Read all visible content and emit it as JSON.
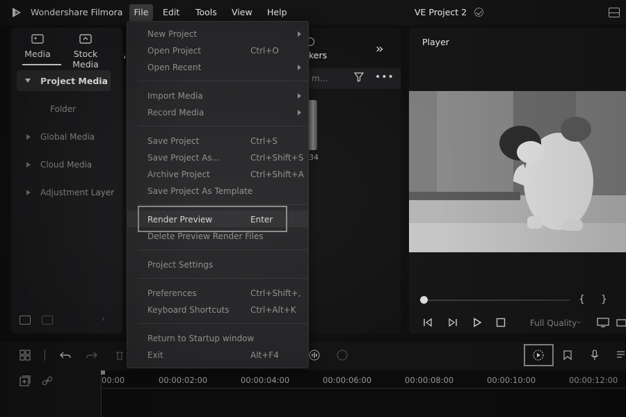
{
  "titlebar": {
    "app_name": "Wondershare Filmora",
    "menus": [
      "File",
      "Edit",
      "Tools",
      "View",
      "Help"
    ],
    "project_title": "VE Project 2"
  },
  "media_panel": {
    "tabs": [
      "Media",
      "Stock Media",
      "A"
    ],
    "items": [
      {
        "label": "Project Media",
        "active": true
      },
      {
        "label": "Folder"
      },
      {
        "label": "Global Media"
      },
      {
        "label": "Cloud Media"
      },
      {
        "label": "Adjustment Layer"
      }
    ]
  },
  "center": {
    "tab_partial": "kers",
    "search_partial": "m...",
    "thumb_label_partial": "34"
  },
  "player": {
    "title": "Player",
    "quality": "Full Quality",
    "brace_open": "{",
    "brace_close": "}"
  },
  "file_menu": {
    "items": [
      {
        "label": "New Project",
        "shortcut": "",
        "submenu": true
      },
      {
        "label": "Open Project",
        "shortcut": "Ctrl+O",
        "submenu": false
      },
      {
        "label": "Open Recent",
        "shortcut": "",
        "submenu": true
      },
      {
        "label": "Import Media",
        "shortcut": "",
        "submenu": true
      },
      {
        "label": "Record Media",
        "shortcut": "",
        "submenu": true
      },
      {
        "label": "Save Project",
        "shortcut": "Ctrl+S",
        "submenu": false
      },
      {
        "label": "Save Project As...",
        "shortcut": "Ctrl+Shift+S",
        "submenu": false
      },
      {
        "label": "Archive Project",
        "shortcut": "Ctrl+Shift+A",
        "submenu": false
      },
      {
        "label": "Save Project As Template",
        "shortcut": "",
        "submenu": false
      },
      {
        "label": "Render Preview",
        "shortcut": "Enter",
        "submenu": false,
        "highlighted": true
      },
      {
        "label": "Delete Preview Render Files",
        "shortcut": "",
        "submenu": false
      },
      {
        "label": "Project Settings",
        "shortcut": "",
        "submenu": false
      },
      {
        "label": "Preferences",
        "shortcut": "Ctrl+Shift+,",
        "submenu": false
      },
      {
        "label": "Keyboard Shortcuts",
        "shortcut": "Ctrl+Alt+K",
        "submenu": false
      },
      {
        "label": "Return to Startup window",
        "shortcut": "",
        "submenu": false
      },
      {
        "label": "Exit",
        "shortcut": "Alt+F4",
        "submenu": false
      }
    ]
  },
  "timeline": {
    "timecodes": [
      "00:00",
      "00:00:02:00",
      "00:00:04:00",
      "00:00:06:00",
      "00:00:08:00",
      "00:00:10:00",
      "00:00:12:00"
    ]
  },
  "icons": {
    "logo": "filmora-logo-icon",
    "verified": "check-circle-icon",
    "layout": "layout-icon",
    "render_preview": "render-preview-icon"
  }
}
